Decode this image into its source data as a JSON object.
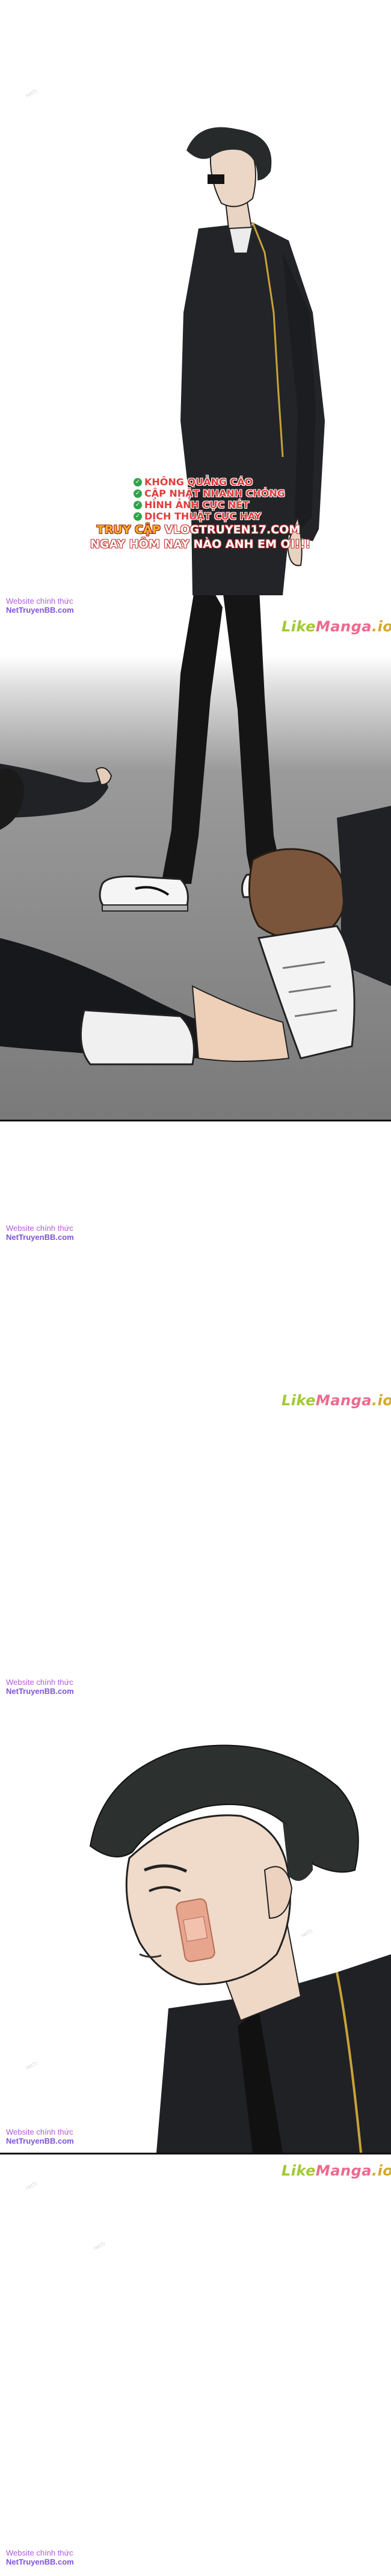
{
  "watermark_site": {
    "line1": "Website chính thức",
    "line2": "NetTruyenBB.com"
  },
  "watermark_brand": {
    "part1": "Like",
    "part2": "Manga",
    "part3": ".io"
  },
  "faint_mark": "netTr",
  "ad": {
    "items": [
      "KHÔNG QUẢNG CÁO",
      "CẬP NHẬT NHANH CHÓNG",
      "HÌNH ẢNH CỰC NÉT",
      "DỊCH THUẬT CỰC HAY"
    ],
    "line1_prefix": "TRUY CẬP ",
    "line1_url": "VLOGTRUYEN17.COM",
    "line2": "NGAY HÔM NAY NÀO ANH EM ƠI!!!"
  },
  "colors": {
    "watermark_purple": "#b25bd6",
    "brand_green": "#9fc932",
    "brand_pink": "#ed6a8e",
    "brand_gold": "#d6a72a",
    "ad_red": "#e33c3c",
    "ad_gold": "#f3b52b"
  },
  "icons": [
    "check-icon",
    "sneaker-illustration",
    "bandage-illustration"
  ]
}
